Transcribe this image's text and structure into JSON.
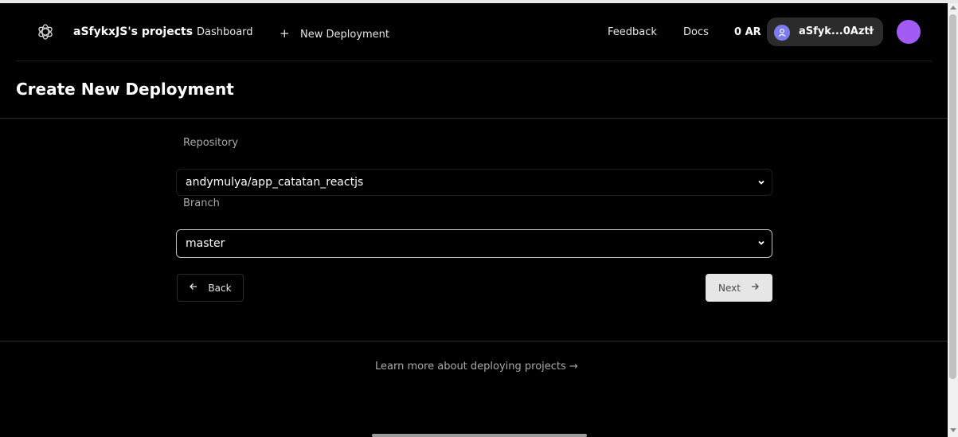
{
  "header": {
    "brand": "aSfykxJS's projects",
    "nav": {
      "dashboard": "Dashboard",
      "new_deployment": "New Deployment",
      "feedback": "Feedback",
      "docs": "Docs"
    },
    "balance": "0 AR",
    "wallet_label": "aSfyk...0AztI"
  },
  "page": {
    "title": "Create New Deployment"
  },
  "form": {
    "repository_label": "Repository",
    "repository_value": "andymulya/app_catatan_reactjs",
    "branch_label": "Branch",
    "branch_value": "master",
    "back_label": "Back",
    "next_label": "Next"
  },
  "footer": {
    "learn_more": "Learn more about deploying projects →"
  },
  "icons": {
    "logo": "logo-icon",
    "plus": "plus-icon",
    "wallet": "user-icon",
    "chevron": "chevron-down-icon",
    "back": "arrow-left-icon",
    "next": "arrow-right-icon"
  },
  "colors": {
    "background": "#000000",
    "wallet_icon": "#7b7cf0",
    "avatar": "#a35bf5",
    "next_button": "#e6e6e6"
  }
}
